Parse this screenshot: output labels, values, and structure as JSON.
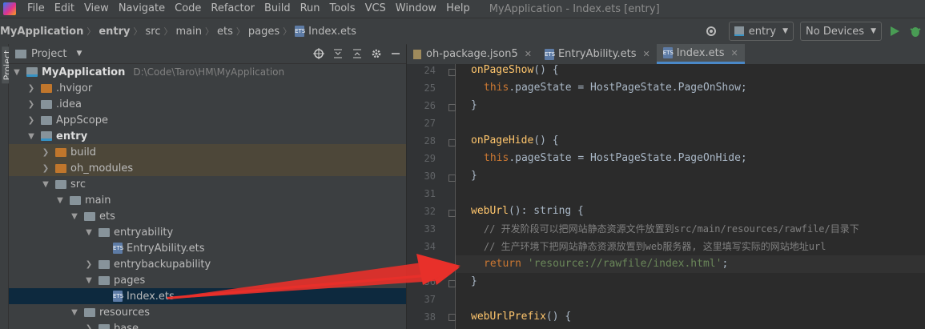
{
  "menubar": {
    "items": [
      "File",
      "Edit",
      "View",
      "Navigate",
      "Code",
      "Refactor",
      "Build",
      "Run",
      "Tools",
      "VCS",
      "Window",
      "Help"
    ],
    "window_title": "MyApplication - Index.ets [entry]"
  },
  "breadcrumb": {
    "items": [
      "MyApplication",
      "entry",
      "src",
      "main",
      "ets",
      "pages",
      "Index.ets"
    ]
  },
  "toolbar": {
    "config_dropdown": "entry",
    "device_dropdown": "No Devices"
  },
  "project_panel": {
    "strip_label": "Project",
    "title": "Project",
    "root_name": "MyApplication",
    "root_path": "D:\\Code\\Taro\\HM\\MyApplication",
    "rows": [
      {
        "label": ".hvigor"
      },
      {
        "label": ".idea"
      },
      {
        "label": "AppScope"
      },
      {
        "label": "entry"
      },
      {
        "label": "build"
      },
      {
        "label": "oh_modules"
      },
      {
        "label": "src"
      },
      {
        "label": "main"
      },
      {
        "label": "ets"
      },
      {
        "label": "entryability"
      },
      {
        "label": "EntryAbility.ets"
      },
      {
        "label": "entrybackupability"
      },
      {
        "label": "pages"
      },
      {
        "label": "Index.ets"
      },
      {
        "label": "resources"
      },
      {
        "label": "base"
      }
    ]
  },
  "editor": {
    "tabs": [
      {
        "label": "oh-package.json5"
      },
      {
        "label": "EntryAbility.ets"
      },
      {
        "label": "Index.ets"
      }
    ],
    "line_numbers": [
      "24",
      "25",
      "26",
      "27",
      "28",
      "29",
      "30",
      "31",
      "32",
      "33",
      "34",
      "35",
      "36",
      "37",
      "38"
    ],
    "code": {
      "l24_fn": "onPageShow",
      "l24_rest": "() {",
      "l25_this": "this",
      "l25_rest": ".pageState = HostPageState.PageOnShow;",
      "l26": "}",
      "l28_fn": "onPageHide",
      "l28_rest": "() {",
      "l29_this": "this",
      "l29_rest": ".pageState = HostPageState.PageOnHide;",
      "l30": "}",
      "l32_fn": "webUrl",
      "l32_rest": "(): string {",
      "l33_cmt": "// 开发阶段可以把网站静态资源文件放置到src/main/resources/rawfile/目录下",
      "l34_cmt": "// 生产环境下把网站静态资源放置到web服务器, 这里填写实际的网站地址url",
      "l35_kw": "return",
      "l35_str": "'resource://rawfile/index.html'",
      "l35_end": ";",
      "l36": "}",
      "l38_fn": "webUrlPrefix",
      "l38_rest": "() {"
    }
  },
  "colors": {
    "arrow": "#e8302a",
    "selection": "#0d293e",
    "excluded": "#4d4739"
  }
}
